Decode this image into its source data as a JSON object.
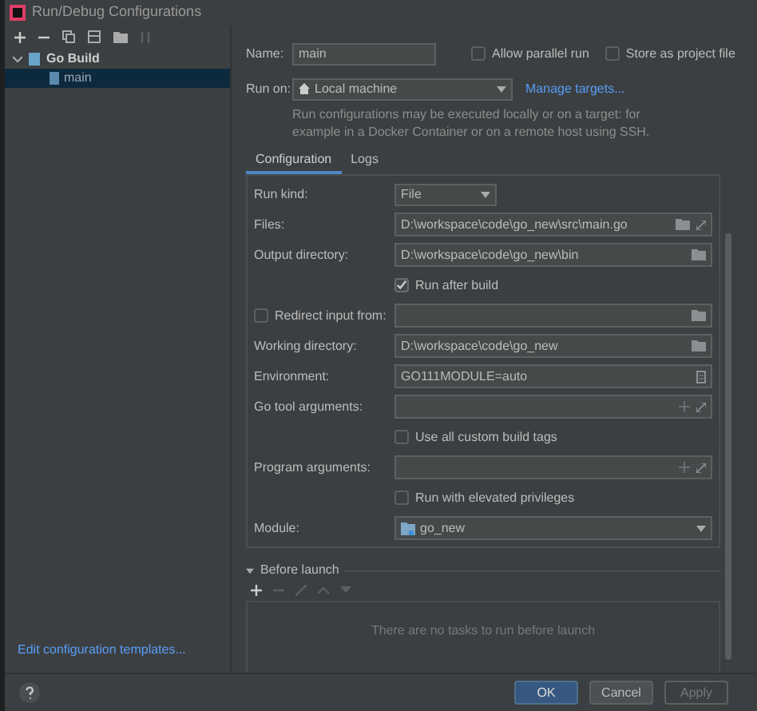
{
  "window": {
    "title": "Run/Debug Configurations"
  },
  "tree": [
    {
      "label": "Go Build",
      "expanded": true,
      "children": [
        {
          "label": "main",
          "selected": true
        }
      ]
    }
  ],
  "edit_templates_link": "Edit configuration templates...",
  "name_field": {
    "label": "Name:",
    "value": "main"
  },
  "allow_parallel": {
    "label": "Allow parallel run",
    "checked": false
  },
  "store_project": {
    "label": "Store as project file",
    "checked": false
  },
  "run_on": {
    "label": "Run on:",
    "value": "Local machine",
    "link": "Manage targets..."
  },
  "run_on_hint": "Run configurations may be executed locally or on a target: for example in a Docker Container or on a remote host using SSH.",
  "tabs": [
    {
      "label": "Configuration",
      "selected": true
    },
    {
      "label": "Logs",
      "selected": false
    }
  ],
  "rows": [
    {
      "kind": "dropdown",
      "label": "Run kind:",
      "value": "File"
    },
    {
      "kind": "field",
      "label": "Files:",
      "value": "D:\\workspace\\code\\go_new\\src\\main.go",
      "browse": true,
      "expand": true
    },
    {
      "kind": "field",
      "label": "Output directory:",
      "value": "D:\\workspace\\code\\go_new\\bin",
      "browse": true
    },
    {
      "kind": "checkbox",
      "label": "Run after build",
      "checked": true
    },
    {
      "kind": "check_field",
      "label": "Redirect input from:",
      "checked": false,
      "browse": true
    },
    {
      "kind": "field",
      "label": "Working directory:",
      "value": "D:\\workspace\\code\\go_new",
      "browse": true
    },
    {
      "kind": "field",
      "label": "Environment:",
      "value": "GO111MODULE=auto",
      "edit_list": true
    },
    {
      "kind": "field",
      "label": "Go tool arguments:",
      "add": true,
      "expand": true
    },
    {
      "kind": "checkbox",
      "label": "Use all custom build tags",
      "checked": false
    },
    {
      "kind": "field",
      "label": "Program arguments:",
      "add": true,
      "expand": true
    },
    {
      "kind": "checkbox",
      "label": "Run with elevated privileges",
      "checked": false
    },
    {
      "kind": "module",
      "label": "Module:",
      "value": "go_new"
    }
  ],
  "before_launch": {
    "label": "Before launch",
    "expanded": true,
    "empty_text": "There are no tasks to run before launch"
  },
  "buttons": [
    {
      "label": "OK",
      "kind": "primary"
    },
    {
      "label": "Cancel",
      "kind": "normal"
    },
    {
      "label": "Apply",
      "kind": "disabled"
    }
  ]
}
